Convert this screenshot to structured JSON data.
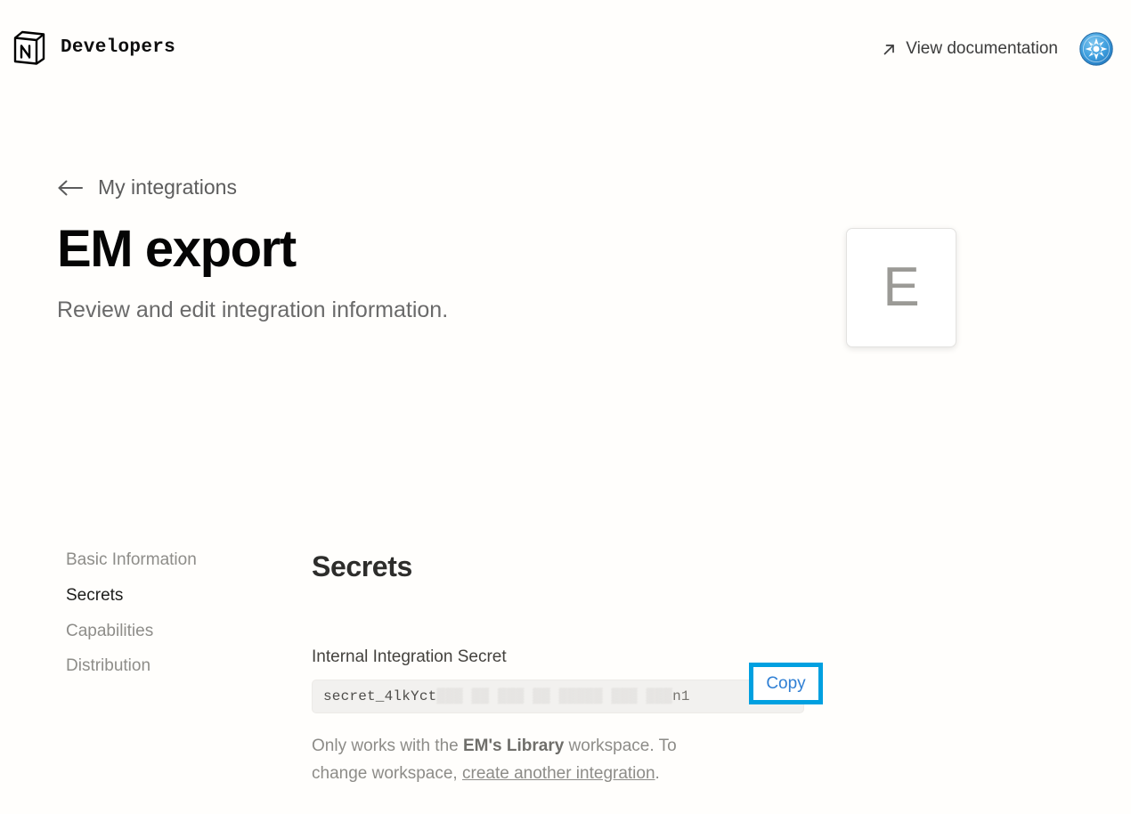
{
  "header": {
    "brand_name": "Developers",
    "logo_icon": "notion-cube-icon",
    "doc_link_label": "View documentation",
    "doc_link_icon": "arrow-up-right-icon",
    "avatar_icon": "user-avatar-star"
  },
  "breadcrumb": {
    "back_icon": "arrow-left-icon",
    "label": "My integrations"
  },
  "hero": {
    "title": "EM export",
    "subtitle": "Review and edit integration information.",
    "avatar_letter": "E"
  },
  "sidebar": {
    "items": [
      {
        "label": "Basic Information",
        "active": false
      },
      {
        "label": "Secrets",
        "active": true
      },
      {
        "label": "Capabilities",
        "active": false
      },
      {
        "label": "Distribution",
        "active": false
      }
    ]
  },
  "secrets": {
    "section_title": "Secrets",
    "field_label": "Internal Integration Secret",
    "secret_visible_prefix": "secret_4lkYct",
    "secret_masked_middle": "▒▒▒ ▒▒ ▒▒▒ ▒▒ ▒▒▒▒▒ ▒▒▒ ▒▒▒",
    "secret_visible_tail": "n1",
    "copy_label": "Copy",
    "helper_prefix": "Only works with the ",
    "helper_workspace": "EM's Library",
    "helper_middle": " workspace. To change workspace, ",
    "helper_link": "create another integration",
    "helper_suffix": "."
  },
  "colors": {
    "page_background": "#fffefc",
    "highlight_border": "#00a0e0",
    "link_blue": "#2f7fd4",
    "avatar_blue": "#2e8fd4",
    "muted_text": "#8d8c88"
  }
}
